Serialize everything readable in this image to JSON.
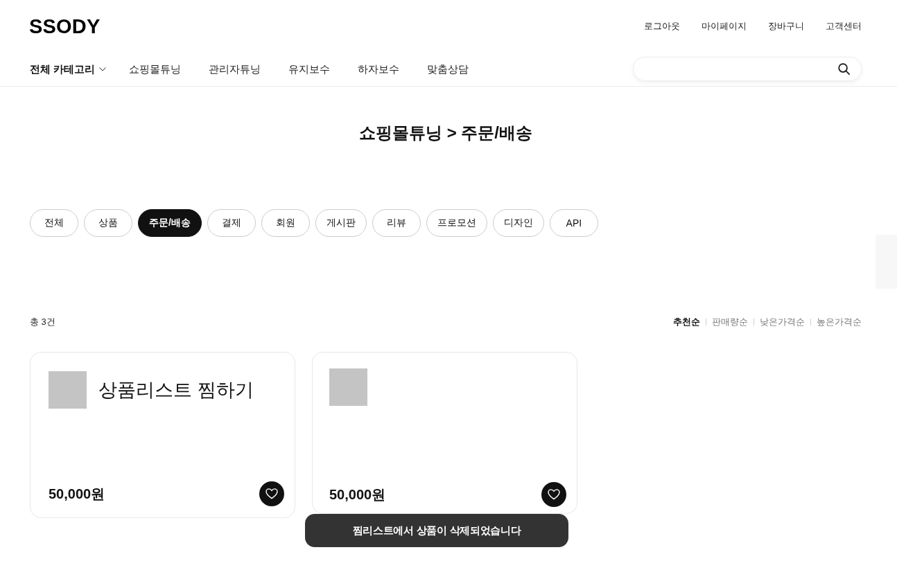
{
  "header": {
    "logo": "SSODY",
    "top_links": [
      "로그아웃",
      "마이페이지",
      "장바구니",
      "고객센터"
    ]
  },
  "nav": {
    "all_categories": "전체 카테고리",
    "items": [
      "쇼핑몰튜닝",
      "관리자튜닝",
      "유지보수",
      "하자보수",
      "맞춤상담"
    ]
  },
  "page_title": "쇼핑몰튜닝 > 주문/배송",
  "filters": [
    {
      "label": "전체",
      "selected": false
    },
    {
      "label": "상품",
      "selected": false
    },
    {
      "label": "주문/배송",
      "selected": true
    },
    {
      "label": "결제",
      "selected": false
    },
    {
      "label": "회원",
      "selected": false
    },
    {
      "label": "게시판",
      "selected": false
    },
    {
      "label": "리뷰",
      "selected": false
    },
    {
      "label": "프로모션",
      "selected": false
    },
    {
      "label": "디자인",
      "selected": false
    },
    {
      "label": "API",
      "selected": false
    }
  ],
  "result_count": "총 3건",
  "sort_options": [
    {
      "label": "추천순",
      "selected": true
    },
    {
      "label": "판매량순",
      "selected": false
    },
    {
      "label": "낮은가격순",
      "selected": false
    },
    {
      "label": "높은가격순",
      "selected": false
    }
  ],
  "products": [
    {
      "title": "상품리스트 찜하기",
      "price": "50,000원"
    },
    {
      "price": "50,000원"
    }
  ],
  "toast": "찜리스트에서 상품이 삭제되었습니다"
}
